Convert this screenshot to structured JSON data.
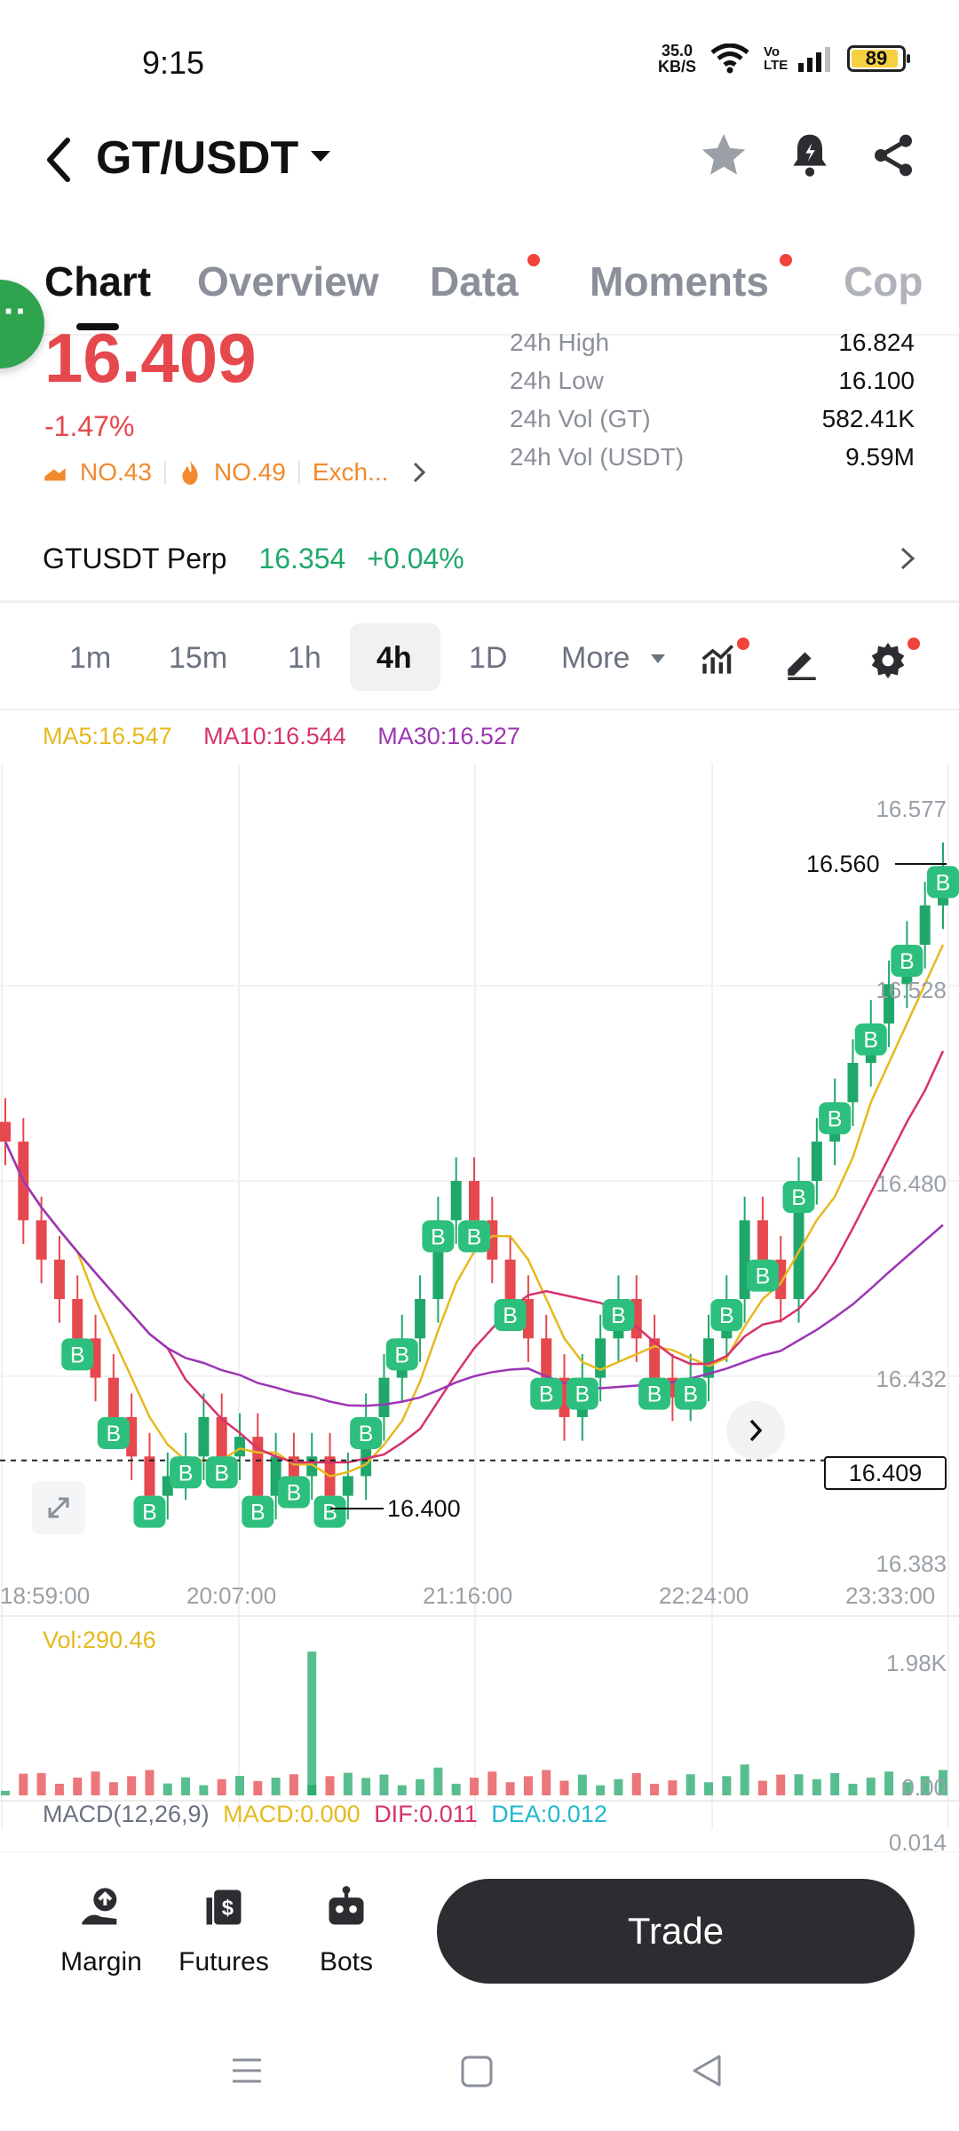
{
  "status": {
    "time": "9:15",
    "net_speed_value": "35.0",
    "net_speed_unit": "KB/S",
    "battery": "89",
    "volte": "Vo LTE"
  },
  "header": {
    "pair": "GT/USDT"
  },
  "tabs": [
    {
      "label": "Chart",
      "active": true,
      "dot": false
    },
    {
      "label": "Overview",
      "active": false,
      "dot": false
    },
    {
      "label": "Data",
      "active": false,
      "dot": true
    },
    {
      "label": "Moments",
      "active": false,
      "dot": true
    },
    {
      "label": "Cop",
      "active": false,
      "dot": false
    }
  ],
  "ticker": {
    "price": "16.409",
    "change_pct": "-1.47%",
    "rank1": "NO.43",
    "rank2": "NO.49",
    "exchange": "Exch...",
    "stats": [
      {
        "k": "24h High",
        "v": "16.824"
      },
      {
        "k": "24h Low",
        "v": "16.100"
      },
      {
        "k": "24h Vol (GT)",
        "v": "582.41K"
      },
      {
        "k": "24h Vol (USDT)",
        "v": "9.59M"
      }
    ]
  },
  "perp": {
    "name": "GTUSDT Perp",
    "price": "16.354",
    "change": "+0.04%"
  },
  "timeframes": [
    "1m",
    "15m",
    "1h",
    "4h",
    "1D",
    "More"
  ],
  "active_timeframe": "4h",
  "ma": {
    "ma5": "MA5:16.547",
    "ma10": "MA10:16.544",
    "ma30": "MA30:16.527"
  },
  "colors": {
    "up": "#20a86b",
    "down": "#e5484d",
    "ma5": "#e6b91e",
    "ma10": "#d6336c",
    "ma30": "#9c36b5",
    "marker": "#2dbf7d"
  },
  "chart_data": {
    "type": "line",
    "y_ticks": [
      "16.577",
      "16.528",
      "16.480",
      "16.432",
      "16.383"
    ],
    "x_ticks": [
      "18:59:00",
      "20:07:00",
      "21:16:00",
      "22:24:00",
      "23:33:00"
    ],
    "last_price_label": "16.409",
    "high_marker": "16.560",
    "low_marker": "16.400",
    "ylim": [
      16.383,
      16.577
    ],
    "close": [
      16.49,
      16.47,
      16.46,
      16.45,
      16.44,
      16.43,
      16.42,
      16.41,
      16.4,
      16.405,
      16.41,
      16.42,
      16.41,
      16.415,
      16.4,
      16.41,
      16.405,
      16.41,
      16.4,
      16.405,
      16.42,
      16.43,
      16.44,
      16.45,
      16.47,
      16.48,
      16.47,
      16.46,
      16.45,
      16.44,
      16.43,
      16.42,
      16.43,
      16.44,
      16.45,
      16.44,
      16.43,
      16.425,
      16.43,
      16.44,
      16.45,
      16.47,
      16.46,
      16.45,
      16.48,
      16.49,
      16.5,
      16.51,
      16.52,
      16.53,
      16.54,
      16.55,
      16.56
    ],
    "marker_label": "B",
    "vol_label": "Vol:290.46",
    "vol_ticks": [
      "1.98K",
      "0.00"
    ],
    "macd_label": "MACD(12,26,9)",
    "macd": "MACD:0.000",
    "dif": "DIF:0.011",
    "dea": "DEA:0.012",
    "macd_tick": "0.014"
  },
  "bottom_nav": [
    {
      "label": "Margin"
    },
    {
      "label": "Futures"
    },
    {
      "label": "Bots"
    }
  ],
  "trade_button": "Trade"
}
